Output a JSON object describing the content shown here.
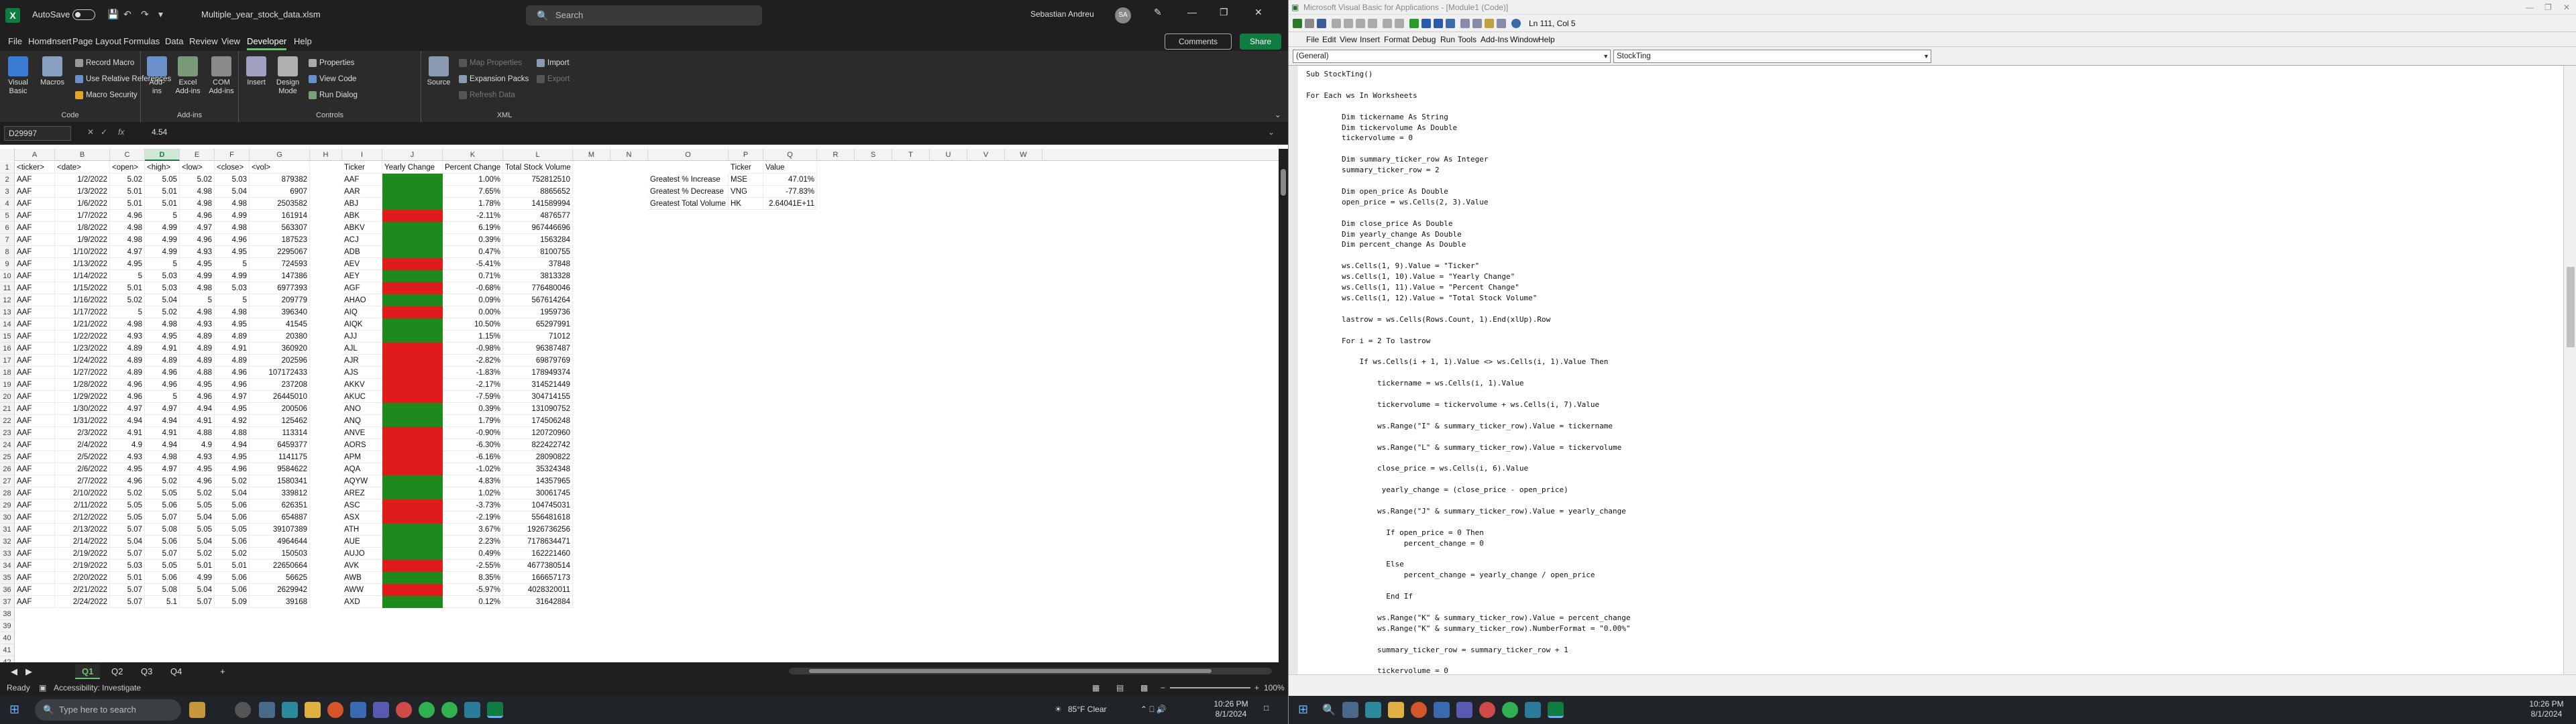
{
  "excel": {
    "autosave_label": "AutoSave",
    "autosave_state": "Off",
    "filename": "Multiple_year_stock_data.xlsm",
    "search_placeholder": "Search",
    "user_name": "Sebastian Andreu",
    "user_initials": "SA",
    "menu": [
      "File",
      "Home",
      "Insert",
      "Page Layout",
      "Formulas",
      "Data",
      "Review",
      "View",
      "Developer",
      "Help"
    ],
    "active_menu": "Developer",
    "comments_label": "Comments",
    "share_label": "Share",
    "ribbon": {
      "code_group": {
        "label": "Code",
        "visual_basic": "Visual Basic",
        "macros": "Macros",
        "record_macro": "Record Macro",
        "use_relative": "Use Relative References",
        "macro_security": "Macro Security"
      },
      "addins_group": {
        "label": "Add-ins",
        "addins": "Add-ins",
        "excel_addins": "Excel Add-ins",
        "com_addins": "COM Add-ins"
      },
      "controls_group": {
        "label": "Controls",
        "insert": "Insert",
        "design_mode": "Design Mode",
        "properties": "Properties",
        "view_code": "View Code",
        "run_dialog": "Run Dialog"
      },
      "xml_group": {
        "label": "XML",
        "source": "Source",
        "map_properties": "Map Properties",
        "expansion_packs": "Expansion Packs",
        "refresh_data": "Refresh Data",
        "import": "Import",
        "export": "Export"
      }
    },
    "name_box": "D29997",
    "formula_value": "4.54",
    "columns": [
      "A",
      "B",
      "C",
      "D",
      "E",
      "F",
      "G",
      "H",
      "I",
      "J",
      "K",
      "L",
      "M",
      "N",
      "O",
      "P",
      "Q",
      "R",
      "S",
      "T",
      "U",
      "V",
      "W"
    ],
    "header_row": [
      "<ticker>",
      "<date>",
      "<open>",
      "<high>",
      "<low>",
      "<close>",
      "<vol>",
      "",
      "Ticker",
      "Yearly Change",
      "Percent Change",
      "Total Stock Volume"
    ],
    "rows": [
      [
        "AAF",
        "1/2/2022",
        "5.02",
        "5.05",
        "5.02",
        "5.03",
        "879382",
        "",
        "AAF",
        "",
        "1.00%",
        "752812510"
      ],
      [
        "AAF",
        "1/3/2022",
        "5.01",
        "5.01",
        "4.98",
        "5.04",
        "6907",
        "",
        "AAR",
        "",
        "7.65%",
        "8865652"
      ],
      [
        "AAF",
        "1/6/2022",
        "5.01",
        "5.01",
        "4.98",
        "4.98",
        "2503582",
        "",
        "ABJ",
        "",
        "1.78%",
        "141589994"
      ],
      [
        "AAF",
        "1/7/2022",
        "4.96",
        "5",
        "4.96",
        "4.99",
        "161914",
        "",
        "ABK",
        "",
        "-2.11%",
        "4876577"
      ],
      [
        "AAF",
        "1/8/2022",
        "4.98",
        "4.99",
        "4.97",
        "4.98",
        "563307",
        "",
        "ABKV",
        "",
        "6.19%",
        "967446696"
      ],
      [
        "AAF",
        "1/9/2022",
        "4.98",
        "4.99",
        "4.96",
        "4.96",
        "187523",
        "",
        "ACJ",
        "",
        "0.39%",
        "1563284"
      ],
      [
        "AAF",
        "1/10/2022",
        "4.97",
        "4.99",
        "4.93",
        "4.95",
        "2295067",
        "",
        "ADB",
        "",
        "0.47%",
        "8100755"
      ],
      [
        "AAF",
        "1/13/2022",
        "4.95",
        "5",
        "4.95",
        "5",
        "724593",
        "",
        "AEV",
        "",
        "-5.41%",
        "37848"
      ],
      [
        "AAF",
        "1/14/2022",
        "5",
        "5.03",
        "4.99",
        "4.99",
        "147386",
        "",
        "AEY",
        "",
        "0.71%",
        "3813328"
      ],
      [
        "AAF",
        "1/15/2022",
        "5.01",
        "5.03",
        "4.98",
        "5.03",
        "6977393",
        "",
        "AGF",
        "",
        "-0.68%",
        "776480046"
      ],
      [
        "AAF",
        "1/16/2022",
        "5.02",
        "5.04",
        "5",
        "5",
        "209779",
        "",
        "AHAO",
        "",
        "0.09%",
        "567614264"
      ],
      [
        "AAF",
        "1/17/2022",
        "5",
        "5.02",
        "4.98",
        "4.98",
        "396340",
        "",
        "AIQ",
        "",
        "0.00%",
        "1959736"
      ],
      [
        "AAF",
        "1/21/2022",
        "4.98",
        "4.98",
        "4.93",
        "4.95",
        "41545",
        "",
        "AIQK",
        "",
        "10.50%",
        "65297991"
      ],
      [
        "AAF",
        "1/22/2022",
        "4.93",
        "4.95",
        "4.89",
        "4.89",
        "20380",
        "",
        "AJJ",
        "",
        "1.15%",
        "71012"
      ],
      [
        "AAF",
        "1/23/2022",
        "4.89",
        "4.91",
        "4.89",
        "4.91",
        "360920",
        "",
        "AJL",
        "",
        "-0.98%",
        "96387487"
      ],
      [
        "AAF",
        "1/24/2022",
        "4.89",
        "4.89",
        "4.89",
        "4.89",
        "202596",
        "",
        "AJR",
        "",
        "-2.82%",
        "69879769"
      ],
      [
        "AAF",
        "1/27/2022",
        "4.89",
        "4.96",
        "4.88",
        "4.96",
        "107172433",
        "",
        "AJS",
        "",
        "-1.83%",
        "178949374"
      ],
      [
        "AAF",
        "1/28/2022",
        "4.96",
        "4.96",
        "4.95",
        "4.96",
        "237208",
        "",
        "AKKV",
        "",
        "-2.17%",
        "314521449"
      ],
      [
        "AAF",
        "1/29/2022",
        "4.96",
        "5",
        "4.96",
        "4.97",
        "26445010",
        "",
        "AKUC",
        "",
        "-7.59%",
        "304714155"
      ],
      [
        "AAF",
        "1/30/2022",
        "4.97",
        "4.97",
        "4.94",
        "4.95",
        "200506",
        "",
        "ANO",
        "",
        "0.39%",
        "131090752"
      ],
      [
        "AAF",
        "1/31/2022",
        "4.94",
        "4.94",
        "4.91",
        "4.92",
        "125462",
        "",
        "ANQ",
        "",
        "1.79%",
        "174506248"
      ],
      [
        "AAF",
        "2/3/2022",
        "4.91",
        "4.91",
        "4.88",
        "4.88",
        "113314",
        "",
        "ANVE",
        "",
        "-0.90%",
        "120720960"
      ],
      [
        "AAF",
        "2/4/2022",
        "4.9",
        "4.94",
        "4.9",
        "4.94",
        "6459377",
        "",
        "AORS",
        "",
        "-6.30%",
        "822422742"
      ],
      [
        "AAF",
        "2/5/2022",
        "4.93",
        "4.98",
        "4.93",
        "4.95",
        "1141175",
        "",
        "APM",
        "",
        "-6.16%",
        "28090822"
      ],
      [
        "AAF",
        "2/6/2022",
        "4.95",
        "4.97",
        "4.95",
        "4.96",
        "9584622",
        "",
        "AQA",
        "",
        "-1.02%",
        "35324348"
      ],
      [
        "AAF",
        "2/7/2022",
        "4.96",
        "5.02",
        "4.96",
        "5.02",
        "1580341",
        "",
        "AQYW",
        "",
        "4.83%",
        "14357965"
      ],
      [
        "AAF",
        "2/10/2022",
        "5.02",
        "5.05",
        "5.02",
        "5.04",
        "339812",
        "",
        "AREZ",
        "",
        "1.02%",
        "30061745"
      ],
      [
        "AAF",
        "2/11/2022",
        "5.05",
        "5.06",
        "5.05",
        "5.06",
        "626351",
        "",
        "ASC",
        "",
        "-3.73%",
        "104745031"
      ],
      [
        "AAF",
        "2/12/2022",
        "5.05",
        "5.07",
        "5.04",
        "5.06",
        "654887",
        "",
        "ASX",
        "",
        "-2.19%",
        "556481618"
      ],
      [
        "AAF",
        "2/13/2022",
        "5.07",
        "5.08",
        "5.05",
        "5.05",
        "39107389",
        "",
        "ATH",
        "",
        "3.67%",
        "1926736256"
      ],
      [
        "AAF",
        "2/14/2022",
        "5.04",
        "5.06",
        "5.04",
        "5.06",
        "4964644",
        "",
        "AUE",
        "",
        "2.23%",
        "7178634471"
      ],
      [
        "AAF",
        "2/19/2022",
        "5.07",
        "5.07",
        "5.02",
        "5.02",
        "150503",
        "",
        "AUJO",
        "",
        "0.49%",
        "162221460"
      ],
      [
        "AAF",
        "2/19/2022",
        "5.03",
        "5.05",
        "5.01",
        "5.01",
        "22650664",
        "",
        "AVK",
        "",
        "-2.55%",
        "4677380514"
      ],
      [
        "AAF",
        "2/20/2022",
        "5.01",
        "5.06",
        "4.99",
        "5.06",
        "56625",
        "",
        "AWB",
        "",
        "8.35%",
        "166657173"
      ],
      [
        "AAF",
        "2/21/2022",
        "5.07",
        "5.08",
        "5.04",
        "5.06",
        "2629942",
        "",
        "AWW",
        "",
        "-5.97%",
        "4028320011"
      ],
      [
        "AAF",
        "2/24/2022",
        "5.07",
        "5.1",
        "5.07",
        "5.09",
        "39168",
        "",
        "AXD",
        "",
        "0.12%",
        "31642884"
      ]
    ],
    "yearly_change_colors": [
      "green",
      "green",
      "green",
      "red",
      "green",
      "green",
      "green",
      "red",
      "green",
      "red",
      "green",
      "red",
      "green",
      "green",
      "red",
      "red",
      "red",
      "red",
      "red",
      "green",
      "green",
      "red",
      "red",
      "red",
      "red",
      "green",
      "green",
      "red",
      "red",
      "green",
      "green",
      "green",
      "red",
      "green",
      "red",
      "green"
    ],
    "summary": {
      "headers": [
        "",
        "Ticker",
        "Value"
      ],
      "rows": [
        [
          "Greatest % Increase",
          "MSE",
          "47.01%"
        ],
        [
          "Greatest % Decrease",
          "VNG",
          "-77.83%"
        ],
        [
          "Greatest Total Volume",
          "HK",
          "2.64041E+11"
        ]
      ]
    },
    "sheet_tabs": [
      "Q1",
      "Q2",
      "Q3",
      "Q4"
    ],
    "active_sheet": "Q1",
    "status_ready": "Ready",
    "status_accessibility": "Accessibility: Investigate",
    "zoom": "100%"
  },
  "taskbar_left": {
    "search_placeholder": "Type here to search",
    "weather": "85°F  Clear",
    "time": "10:26 PM",
    "date": "8/1/2024"
  },
  "taskbar_right": {
    "time": "10:26 PM",
    "date": "8/1/2024"
  },
  "vba": {
    "title": "Microsoft Visual Basic for Applications - [Module1 (Code)]",
    "position": "Ln 111, Col 5",
    "menu": [
      "File",
      "Edit",
      "View",
      "Insert",
      "Format",
      "Debug",
      "Run",
      "Tools",
      "Add-Ins",
      "Window",
      "Help"
    ],
    "combo_left": "(General)",
    "combo_right": "StockTing",
    "code_lines": [
      "Sub StockTing()",
      "",
      "For Each ws In Worksheets",
      "",
      "        Dim tickername As String",
      "        Dim tickervolume As Double",
      "        tickervolume = 0",
      "",
      "        Dim summary_ticker_row As Integer",
      "        summary_ticker_row = 2",
      "",
      "        Dim open_price As Double",
      "        open_price = ws.Cells(2, 3).Value",
      "",
      "        Dim close_price As Double",
      "        Dim yearly_change As Double",
      "        Dim percent_change As Double",
      "",
      "        ws.Cells(1, 9).Value = \"Ticker\"",
      "        ws.Cells(1, 10).Value = \"Yearly Change\"",
      "        ws.Cells(1, 11).Value = \"Percent Change\"",
      "        ws.Cells(1, 12).Value = \"Total Stock Volume\"",
      "",
      "        lastrow = ws.Cells(Rows.Count, 1).End(xlUp).Row",
      "",
      "        For i = 2 To lastrow",
      "",
      "            If ws.Cells(i + 1, 1).Value <> ws.Cells(i, 1).Value Then",
      "",
      "                tickername = ws.Cells(i, 1).Value",
      "",
      "                tickervolume = tickervolume + ws.Cells(i, 7).Value",
      "",
      "                ws.Range(\"I\" & summary_ticker_row).Value = tickername",
      "",
      "                ws.Range(\"L\" & summary_ticker_row).Value = tickervolume",
      "",
      "                close_price = ws.Cells(i, 6).Value",
      "",
      "                 yearly_change = (close_price - open_price)",
      "",
      "                ws.Range(\"J\" & summary_ticker_row).Value = yearly_change",
      "",
      "                  If open_price = 0 Then",
      "                      percent_change = 0",
      "",
      "                  Else",
      "                      percent_change = yearly_change / open_price",
      "",
      "                  End If",
      "",
      "                ws.Range(\"K\" & summary_ticker_row).Value = percent_change",
      "                ws.Range(\"K\" & summary_ticker_row).NumberFormat = \"0.00%\"",
      "",
      "                summary_ticker_row = summary_ticker_row + 1",
      "",
      "                tickervolume = 0"
    ]
  }
}
